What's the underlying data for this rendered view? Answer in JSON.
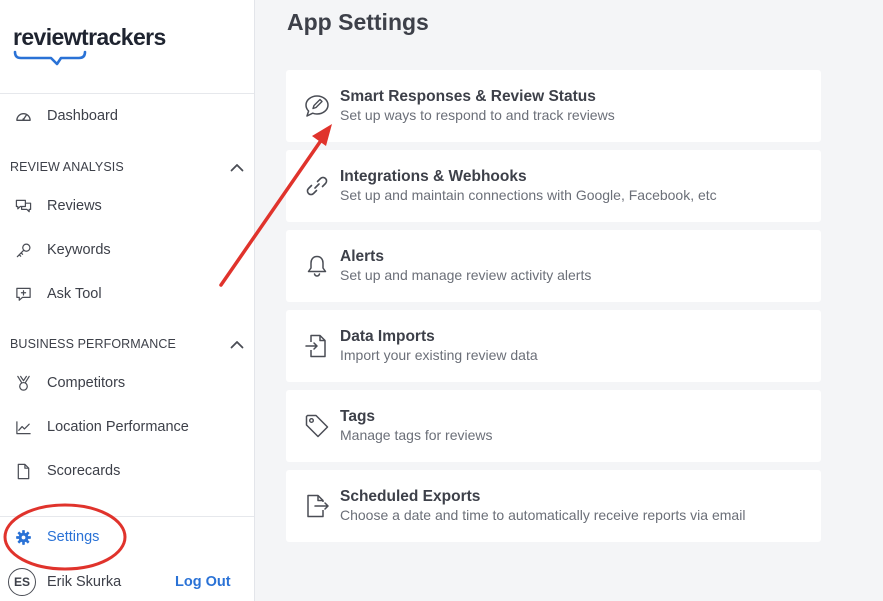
{
  "brand": {
    "name": "reviewtrackers",
    "accent": "#2a72d6",
    "annotation_color": "#e0332c"
  },
  "sidebar": {
    "dashboard": {
      "label": "Dashboard",
      "icon": "dashboard-gauge-icon"
    },
    "review_analysis": {
      "title": "REVIEW ANALYSIS",
      "items": [
        {
          "label": "Reviews",
          "icon": "chat-bubbles-icon"
        },
        {
          "label": "Keywords",
          "icon": "key-icon"
        },
        {
          "label": "Ask Tool",
          "icon": "ask-bubble-icon"
        }
      ]
    },
    "business_performance": {
      "title": "BUSINESS PERFORMANCE",
      "items": [
        {
          "label": "Competitors",
          "icon": "medal-icon"
        },
        {
          "label": "Location Performance",
          "icon": "trend-chart-icon"
        },
        {
          "label": "Scorecards",
          "icon": "document-icon"
        }
      ]
    },
    "settings": {
      "label": "Settings",
      "icon": "gear-icon",
      "active": true
    },
    "user": {
      "initials": "ES",
      "name": "Erik Skurka",
      "logout_label": "Log Out"
    }
  },
  "main": {
    "title": "App Settings",
    "cards": [
      {
        "title": "Smart Responses & Review Status",
        "description": "Set up ways to respond to and track reviews",
        "icon": "chat-edit-icon"
      },
      {
        "title": "Integrations & Webhooks",
        "description": "Set up and maintain connections with Google, Facebook, etc",
        "icon": "link-icon"
      },
      {
        "title": "Alerts",
        "description": "Set up and manage review activity alerts",
        "icon": "bell-icon"
      },
      {
        "title": "Data Imports",
        "description": "Import your existing review data",
        "icon": "import-file-icon"
      },
      {
        "title": "Tags",
        "description": "Manage tags for reviews",
        "icon": "tag-icon"
      },
      {
        "title": "Scheduled Exports",
        "description": "Choose a date and time to automatically receive reports via email",
        "icon": "export-file-icon"
      }
    ]
  }
}
